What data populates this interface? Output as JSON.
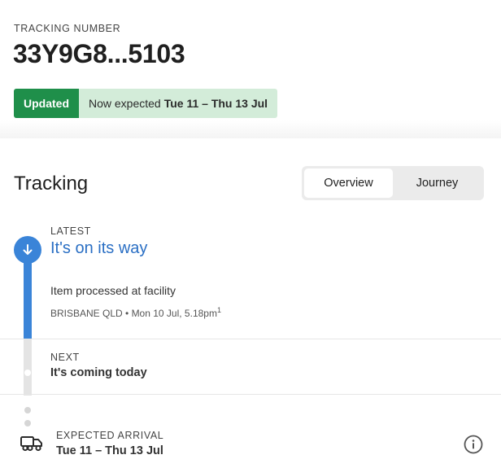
{
  "header": {
    "tracking_label": "TRACKING NUMBER",
    "tracking_number": "33Y9G8...5103",
    "status_badge": "Updated",
    "status_text": "Now expected",
    "status_dates": "Tue 11 – Thu 13 Jul"
  },
  "tracking": {
    "title": "Tracking",
    "tabs": [
      {
        "label": "Overview",
        "active": true
      },
      {
        "label": "Journey",
        "active": false
      }
    ],
    "latest": {
      "label": "LATEST",
      "title": "It's on its way",
      "event": "Item processed at facility",
      "meta": "BRISBANE QLD • Mon 10 Jul, 5.18pm",
      "footnote": "1"
    },
    "next": {
      "label": "NEXT",
      "title": "It's coming today"
    },
    "expected": {
      "label": "EXPECTED ARRIVAL",
      "value": "Tue 11 – Thu 13 Jul"
    }
  },
  "colors": {
    "badge_green": "#1f8f4a",
    "badge_bg": "#d3ecd9",
    "accent_blue": "#3a84d8",
    "title_blue": "#2a6fc4"
  },
  "icons": [
    "down-arrow-icon",
    "truck-icon",
    "info-icon"
  ]
}
